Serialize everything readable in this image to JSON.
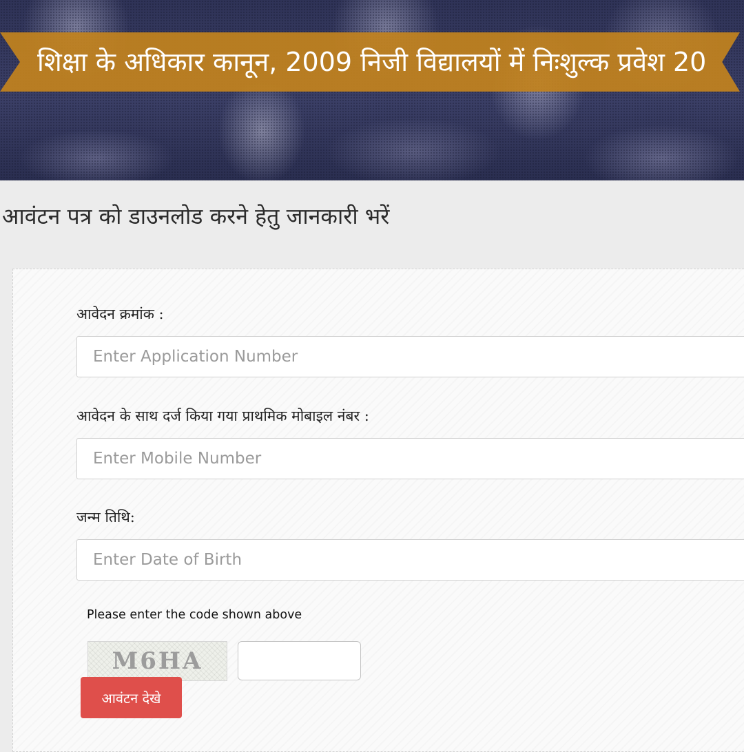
{
  "banner": {
    "title": "शिक्षा के अधिकार कानून, 2009 निजी विद्यालयों में निःशुल्क प्रवेश 20"
  },
  "page": {
    "heading": "आवंटन पत्र को डाउनलोड करने हेतु जानकारी भरें"
  },
  "form": {
    "application_number": {
      "label": "आवेदन क्रमांक :",
      "placeholder": "Enter Application Number",
      "value": ""
    },
    "mobile_number": {
      "label": "आवेदन के साथ दर्ज किया गया प्राथमिक मोबाइल नंबर :",
      "placeholder": "Enter Mobile Number",
      "value": ""
    },
    "date_of_birth": {
      "label": "जन्म तिथि:",
      "placeholder": "Enter Date of Birth",
      "value": ""
    },
    "captcha": {
      "label": "Please enter the code shown above",
      "code": "M6HA",
      "value": ""
    },
    "submit_label": "आवंटन देखे"
  }
}
